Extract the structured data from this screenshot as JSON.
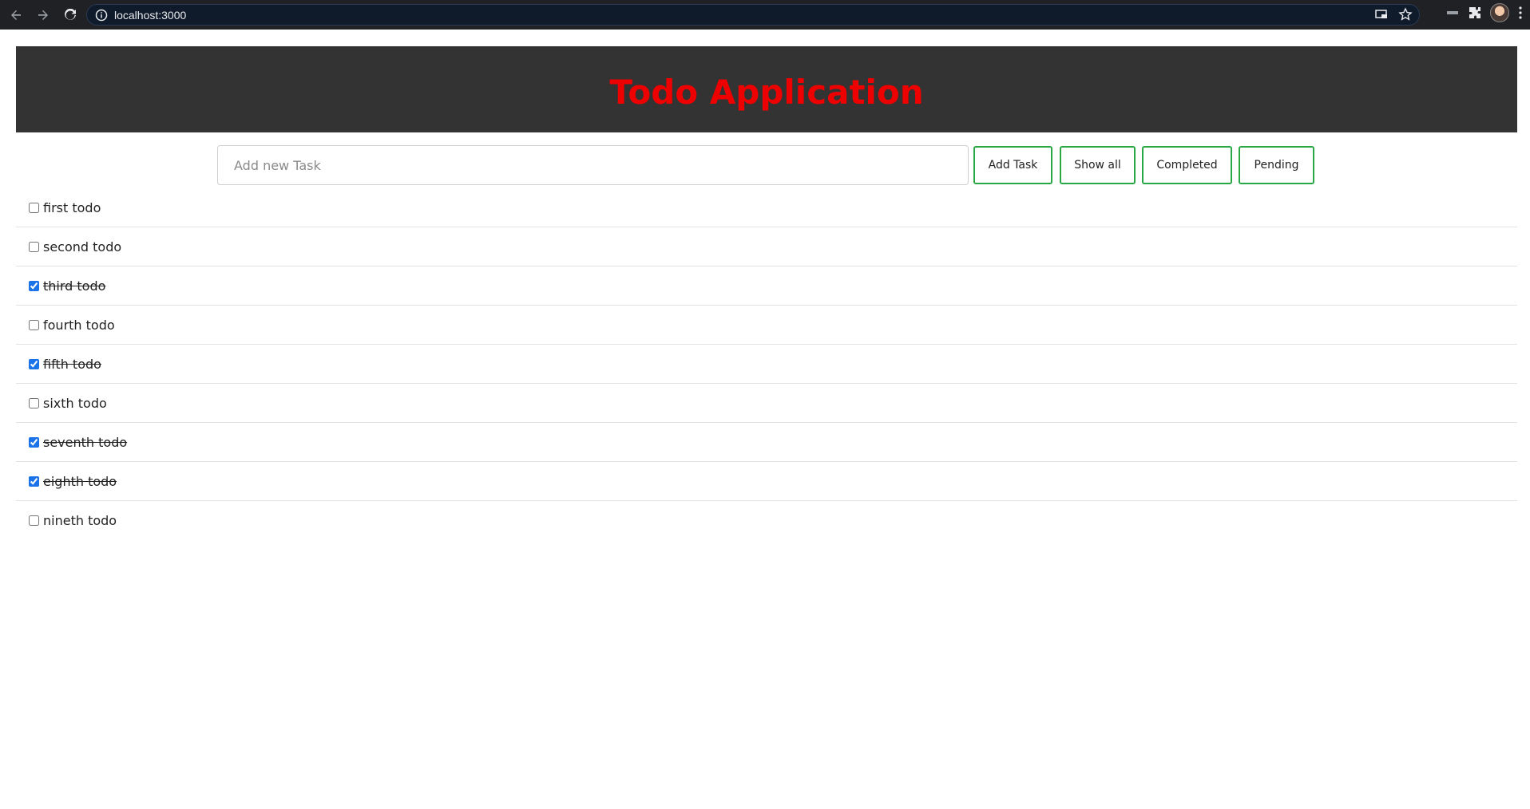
{
  "browser": {
    "url": "localhost:3000",
    "icons": {
      "back": "back-arrow-icon",
      "forward": "forward-arrow-icon",
      "reload": "reload-icon",
      "info": "info-icon",
      "cast": "cast-icon",
      "bookmark": "star-icon",
      "extensions": "puzzle-icon",
      "menu": "kebab-menu-icon"
    }
  },
  "app": {
    "title": "Todo Application",
    "title_color": "#ee0000",
    "header_bg": "#333333",
    "accent_color": "#27a844"
  },
  "controls": {
    "input_placeholder": "Add new Task",
    "input_value": "",
    "add_label": "Add Task",
    "show_all_label": "Show all",
    "completed_label": "Completed",
    "pending_label": "Pending"
  },
  "todos": [
    {
      "text": "first todo",
      "done": false
    },
    {
      "text": "second todo",
      "done": false
    },
    {
      "text": "third todo",
      "done": true
    },
    {
      "text": "fourth todo",
      "done": false
    },
    {
      "text": "fifth todo",
      "done": true
    },
    {
      "text": "sixth todo",
      "done": false
    },
    {
      "text": "seventh todo",
      "done": true
    },
    {
      "text": "eighth todo",
      "done": true
    },
    {
      "text": "nineth todo",
      "done": false
    }
  ]
}
